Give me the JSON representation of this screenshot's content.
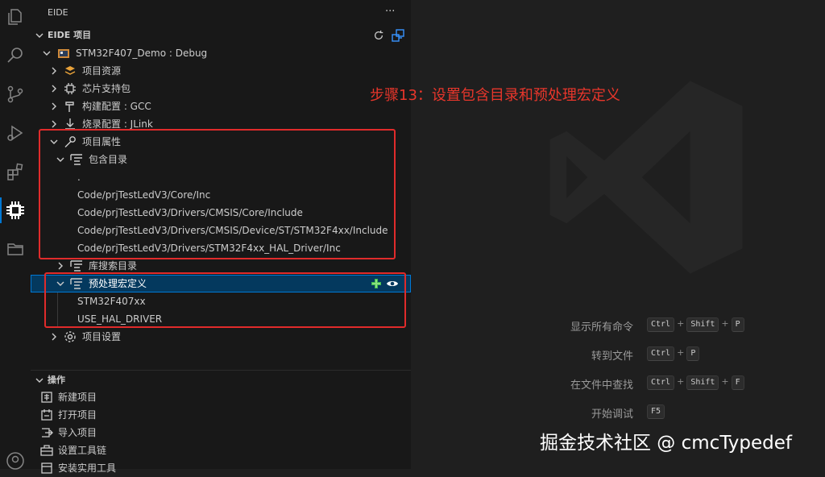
{
  "sidebar": {
    "title": "EIDE",
    "more": "···",
    "section_title": "EIDE 项目",
    "project": "STM32F407_Demo : Debug",
    "nodes": {
      "resources": "项目资源",
      "chip": "芯片支持包",
      "build": "构建配置 : GCC",
      "flash": "烧录配置 : JLink",
      "props": "项目属性",
      "include": "包含目录",
      "lib": "库搜索目录",
      "macro": "预处理宏定义",
      "settings": "项目设置"
    },
    "include_dirs": [
      ".",
      "Code/prjTestLedV3/Core/Inc",
      "Code/prjTestLedV3/Drivers/CMSIS/Core/Include",
      "Code/prjTestLedV3/Drivers/CMSIS/Device/ST/STM32F4xx/Include",
      "Code/prjTestLedV3/Drivers/STM32F4xx_HAL_Driver/Inc"
    ],
    "macros": [
      "STM32F407xx",
      "USE_HAL_DRIVER"
    ],
    "ops_title": "操作",
    "ops": [
      "新建项目",
      "打开项目",
      "导入项目",
      "设置工具链",
      "安装实用工具"
    ]
  },
  "annotation": "步骤13：设置包含目录和预处理宏定义",
  "shortcuts": [
    {
      "label": "显示所有命令",
      "keys": [
        "Ctrl",
        "Shift",
        "P"
      ]
    },
    {
      "label": "转到文件",
      "keys": [
        "Ctrl",
        "P"
      ]
    },
    {
      "label": "在文件中查找",
      "keys": [
        "Ctrl",
        "Shift",
        "F"
      ]
    },
    {
      "label": "开始调试",
      "keys": [
        "F5"
      ]
    }
  ],
  "watermark": "掘金技术社区 @ cmcTypedef",
  "colors": {
    "accent": "#0078d4",
    "annotation": "#e8362b",
    "selection": "#04395e"
  }
}
